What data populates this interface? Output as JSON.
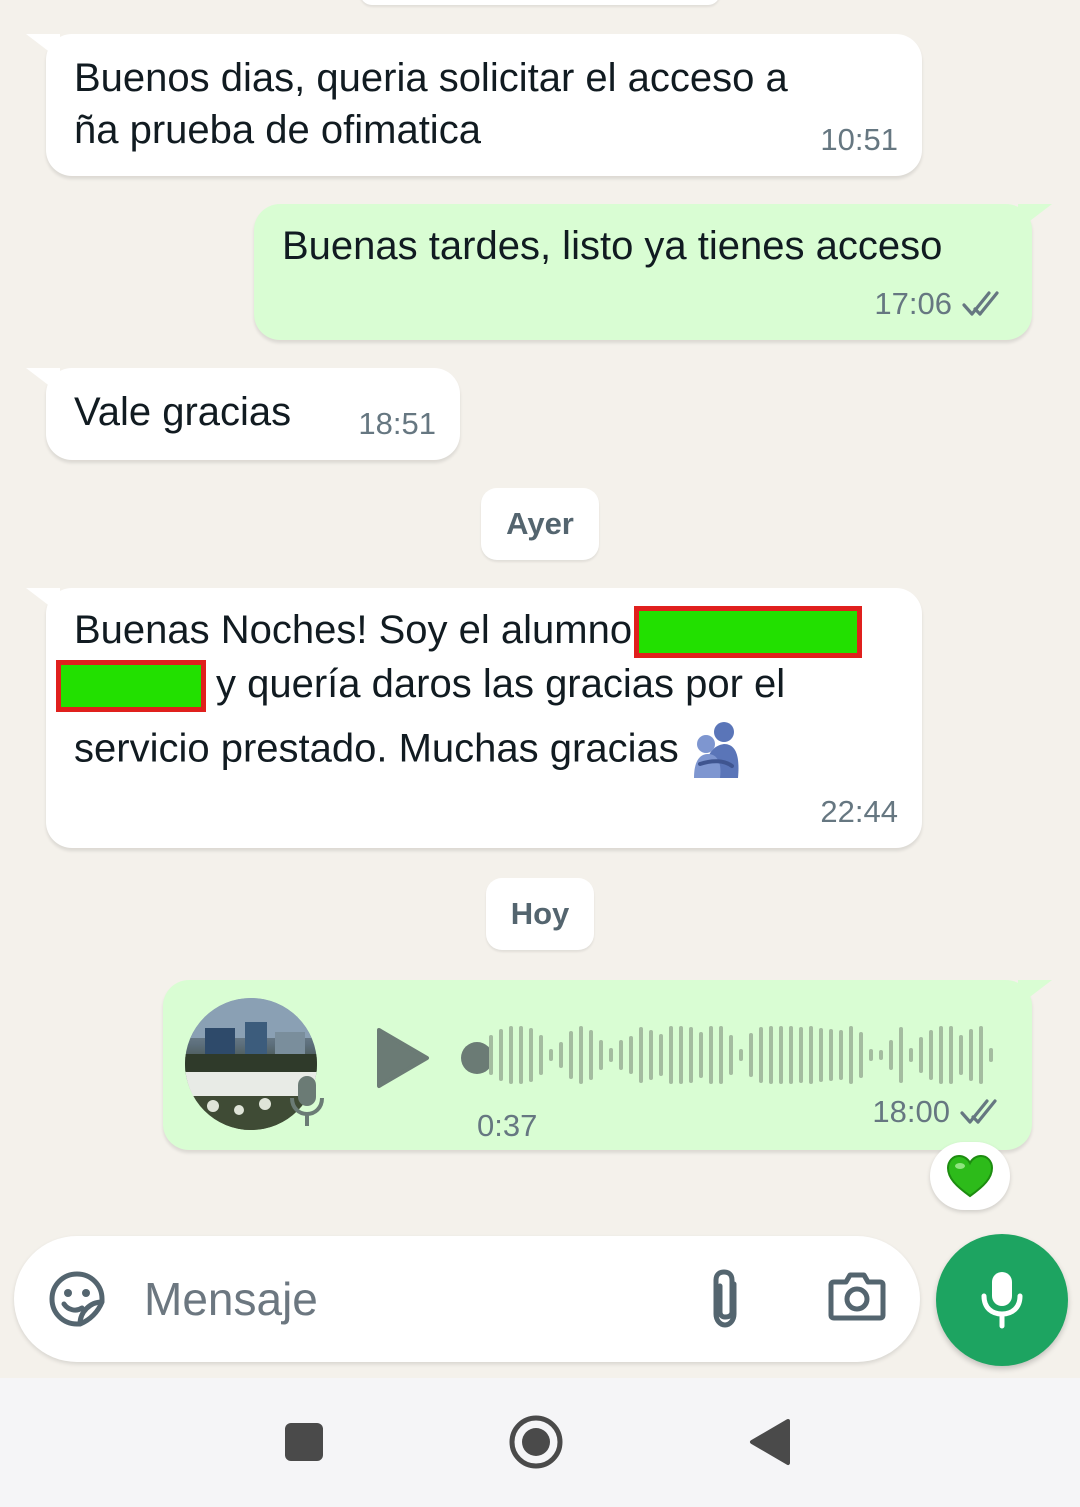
{
  "messages": [
    {
      "direction": "in",
      "line1": "Buenos dias, queria solicitar el acceso a",
      "line2": "ña prueba de ofimatica",
      "time": "10:51"
    },
    {
      "direction": "out",
      "text": "Buenas tardes, listo ya tienes acceso",
      "time": "17:06",
      "status_icon": "double-check-icon"
    },
    {
      "direction": "in",
      "text": "Vale gracias",
      "time": "18:51"
    },
    {
      "direction": "in",
      "line1": "Buenas Noches! Soy el alumno",
      "line2": "y quería daros las gracias por el",
      "line3": "servicio prestado. Muchas gracias",
      "time": "22:44",
      "emoji": "people-hugging-emoji"
    }
  ],
  "day_separators": {
    "ayer": "Ayer",
    "hoy": "Hoy"
  },
  "voice_note": {
    "duration": "0:37",
    "time": "18:00",
    "status_icon": "double-check-icon",
    "reaction": "green-heart-emoji",
    "progress": 0
  },
  "composer": {
    "placeholder": "Mensaje"
  },
  "colors": {
    "background": "#f4f1eb",
    "incoming_bubble": "#ffffff",
    "outgoing_bubble": "#d9fdd3",
    "accent": "#1da461",
    "redaction_fill": "#22e000",
    "redaction_border": "#e0201d"
  }
}
